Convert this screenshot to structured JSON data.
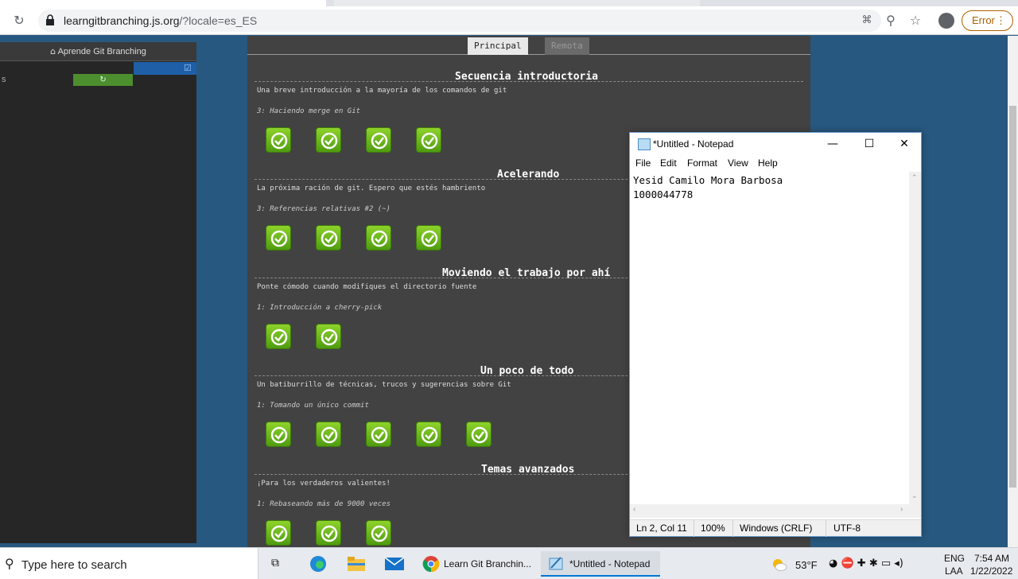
{
  "browser": {
    "url_host": "learngitbranching.js.org",
    "url_path": "/?locale=es_ES",
    "error_label": "Error"
  },
  "left_panel": {
    "header": "Aprende Git Branching",
    "row_label": "s",
    "refresh_symbol": "↻"
  },
  "level_panel": {
    "tabs": [
      "Principal",
      "Remota"
    ],
    "sequences": [
      {
        "title": "Secuencia introductoria",
        "desc": "Una breve introducción a la mayoría de los comandos de git",
        "level": "3: Haciendo merge en Git",
        "badges": 4
      },
      {
        "title": "Acelerando",
        "desc": "La próxima ración de git. Espero que estés hambriento",
        "level": "3: Referencias relativas #2 (~)",
        "badges": 4
      },
      {
        "title": "Moviendo el trabajo por ahí",
        "desc": "Ponte cómodo cuando modifiques el directorio fuente",
        "level": "1: Introducción a cherry-pick",
        "badges": 2
      },
      {
        "title": "Un poco de todo",
        "desc": "Un batiburrillo de técnicas, trucos y sugerencias sobre Git",
        "level": "1: Tomando un único commit",
        "badges": 5
      },
      {
        "title": "Temas avanzados",
        "desc": "¡Para los verdaderos valientes!",
        "level": "1: Rebaseando más de 9000 veces",
        "badges": 3
      }
    ]
  },
  "notepad": {
    "title": "*Untitled - Notepad",
    "menu": [
      "File",
      "Edit",
      "Format",
      "View",
      "Help"
    ],
    "content": "Yesid Camilo Mora Barbosa\n1000044778",
    "status": {
      "position": "Ln 2, Col 11",
      "zoom": "100%",
      "line_endings": "Windows (CRLF)",
      "encoding": "UTF-8"
    }
  },
  "taskbar": {
    "search_placeholder": "Type here to search",
    "apps": [
      "Learn Git Branchin...",
      "*Untitled - Notepad"
    ],
    "weather": "53°F",
    "language": "ENG",
    "layout": "LAA",
    "time": "7:54 AM",
    "date": "1/22/2022"
  }
}
